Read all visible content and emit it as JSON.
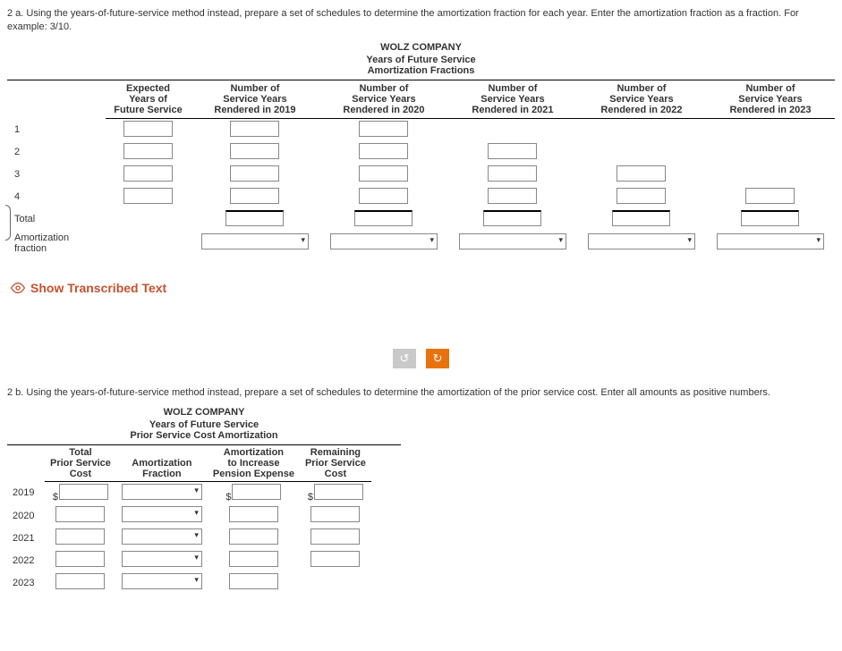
{
  "q2a": {
    "text": "2 a. Using the years-of-future-service method instead, prepare a set of schedules to determine the amortization fraction for each year. Enter the amortization fraction as a fraction. For example: 3/10.",
    "title1": "WOLZ COMPANY",
    "title2": "Years of Future Service",
    "title3": "Amortization Fractions",
    "cols": {
      "c1a": "Expected",
      "c1b": "Years of",
      "c1c": "Future Service",
      "c2a": "Number of",
      "c2b": "Service Years",
      "c2c": "Rendered in 2019",
      "c3a": "Number of",
      "c3b": "Service Years",
      "c3c": "Rendered in 2020",
      "c4a": "Number of",
      "c4b": "Service Years",
      "c4c": "Rendered in 2021",
      "c5a": "Number of",
      "c5b": "Service Years",
      "c5c": "Rendered in 2022",
      "c6a": "Number of",
      "c6b": "Service Years",
      "c6c": "Rendered in 2023"
    },
    "rows": [
      "1",
      "2",
      "3",
      "4",
      "Total",
      "Amortization fraction"
    ]
  },
  "showText": "Show Transcribed Text",
  "q2b": {
    "text": "2 b. Using the years-of-future-service method instead, prepare a set of schedules to determine the amortization of the prior service cost. Enter all amounts as positive numbers.",
    "title1": "WOLZ COMPANY",
    "title2": "Years of Future Service",
    "title3": "Prior Service Cost Amortization",
    "cols": {
      "c1a": "Total",
      "c1b": "Prior Service",
      "c1c": "Cost",
      "c2a": "Amortization",
      "c2b": "Fraction",
      "c3a": "Amortization",
      "c3b": "to Increase",
      "c3c": "Pension Expense",
      "c4a": "Remaining",
      "c4b": "Prior Service",
      "c4c": "Cost"
    },
    "rows": [
      "2019",
      "2020",
      "2021",
      "2022",
      "2023"
    ],
    "dollar": "$"
  }
}
